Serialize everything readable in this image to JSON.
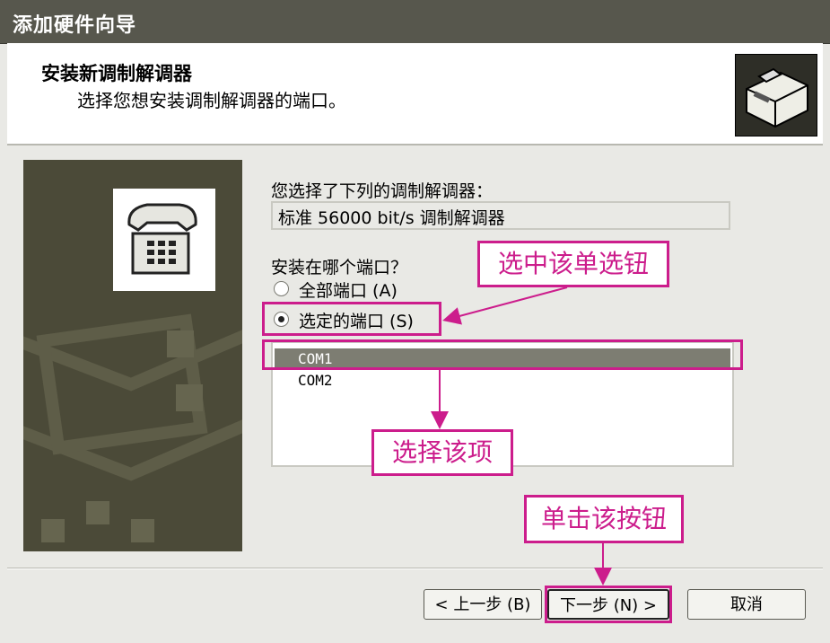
{
  "window": {
    "title": "添加硬件向导"
  },
  "header": {
    "title": "安装新调制解调器",
    "subtitle": "选择您想安装调制解调器的端口。",
    "icon": "hardware-box-icon"
  },
  "side_panel": {
    "icon": "telephone-icon"
  },
  "main": {
    "selected_label": "您选择了下列的调制解调器：",
    "modem_name": "标准 56000 bit/s 调制解调器",
    "port_question": "安装在哪个端口？",
    "radio_all": "全部端口 (A)",
    "radio_selected": "选定的端口 (S)",
    "radio_value": "selected",
    "ports": [
      {
        "name": "COM1",
        "selected": true
      },
      {
        "name": "COM2",
        "selected": false
      }
    ]
  },
  "buttons": {
    "back": "< 上一步 (B)",
    "next": "下一步 (N) >",
    "cancel": "取消"
  },
  "annotations": {
    "radio_note": "选中该单选钮",
    "item_note": "选择该项",
    "button_note": "单击该按钮",
    "color": "#cc1d8c"
  }
}
